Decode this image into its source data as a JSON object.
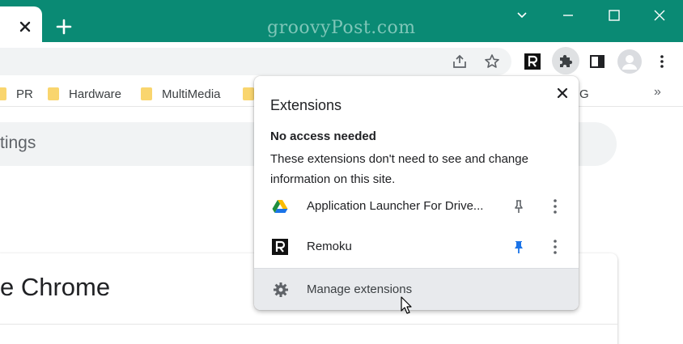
{
  "watermark": "groovyPost.com",
  "titlebar": {
    "close_tab": "close-tab",
    "new_tab": "new-tab"
  },
  "bookmarks": {
    "items": [
      {
        "label": "PR"
      },
      {
        "label": "Hardware"
      },
      {
        "label": "MultiMedia"
      },
      {
        "label": ""
      },
      {
        "label": "G"
      }
    ],
    "more": "»"
  },
  "page": {
    "search_text": "tings",
    "card_title": "e Chrome"
  },
  "extensions_popup": {
    "title": "Extensions",
    "section_heading": "No access needed",
    "section_description": "These extensions don't need to see and change information on this site.",
    "items": [
      {
        "name": "Application Launcher For Drive...",
        "icon": "google-drive-icon",
        "pinned": false
      },
      {
        "name": "Remoku",
        "icon": "remoku-icon",
        "pinned": true
      }
    ],
    "manage_label": "Manage extensions"
  },
  "colors": {
    "titlebar": "#0a8a74",
    "accent_pin": "#1a73e8",
    "folder": "#f9d56e"
  }
}
